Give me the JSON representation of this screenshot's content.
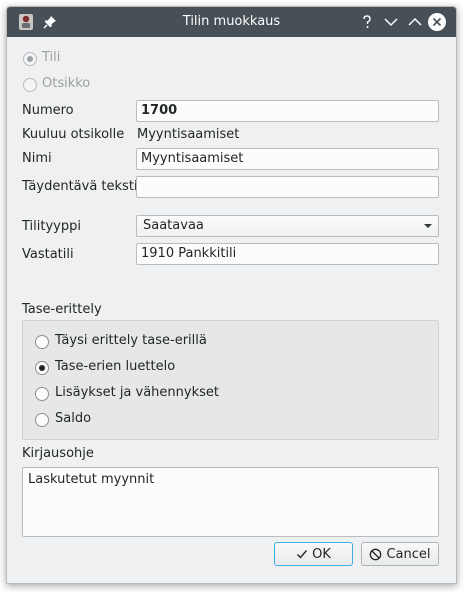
{
  "window": {
    "title": "Tilin muokkaus"
  },
  "icons": {
    "app": "app-icon",
    "pin": "pin-icon",
    "help": "help-icon",
    "minimize": "chevron-down-icon",
    "maximize": "chevron-up-icon",
    "close": "close-icon",
    "ok": "checkmark-icon",
    "cancel": "cancel-icon"
  },
  "type_radio": {
    "tili": {
      "label": "Tili",
      "checked": true,
      "enabled": false
    },
    "otsikko": {
      "label": "Otsikko",
      "checked": false,
      "enabled": false
    }
  },
  "form": {
    "numero": {
      "label": "Numero",
      "value": "1700"
    },
    "kuuluu": {
      "label": "Kuuluu otsikolle",
      "value": "Myyntisaamiset"
    },
    "nimi": {
      "label": "Nimi",
      "value": "Myyntisaamiset"
    },
    "taydentava": {
      "label": "Täydentävä teksti",
      "value": ""
    },
    "tilityyppi": {
      "label": "Tilityyppi",
      "value": "Saatavaa"
    },
    "vastatili": {
      "label": "Vastatili",
      "value": "1910 Pankkitili"
    }
  },
  "tase": {
    "title": "Tase-erittely",
    "options": [
      {
        "label": "Täysi erittely tase-erillä",
        "checked": false
      },
      {
        "label": "Tase-erien luettelo",
        "checked": true
      },
      {
        "label": "Lisäykset ja vähennykset",
        "checked": false
      },
      {
        "label": "Saldo",
        "checked": false
      }
    ]
  },
  "kirjausohje": {
    "label": "Kirjausohje",
    "text": "Laskutetut myynnit"
  },
  "buttons": {
    "ok": "OK",
    "cancel": "Cancel"
  },
  "colors": {
    "titlebar": "#475057",
    "window_bg": "#eff0f1",
    "focus_accent": "#3daee9"
  }
}
